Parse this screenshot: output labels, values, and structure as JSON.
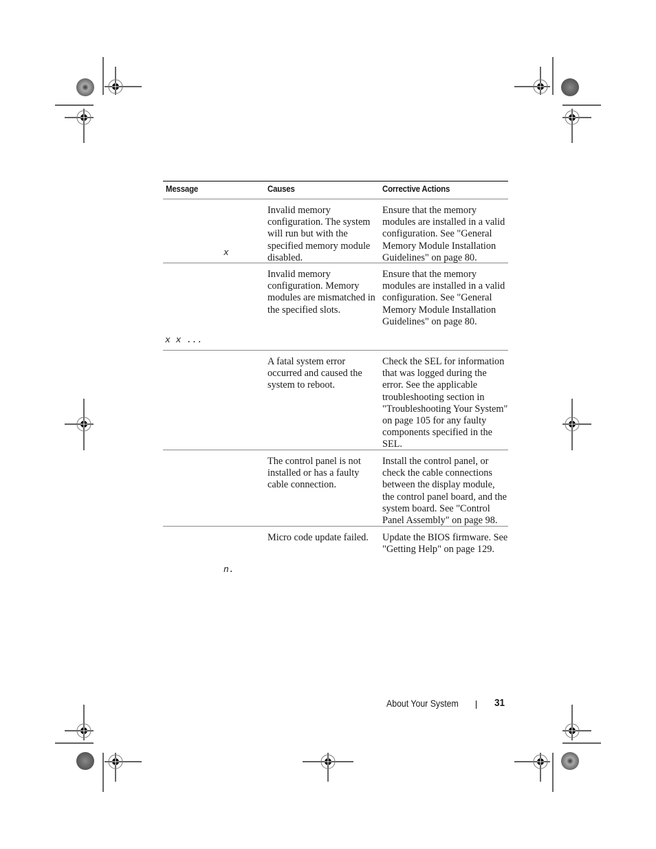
{
  "table": {
    "headers": [
      "Message",
      "Causes",
      "Corrective Actions"
    ],
    "rows": [
      {
        "message_fragment": "x",
        "causes": "Invalid memory configuration. The system will run but with the specified memory module disabled.",
        "actions": "Ensure that the memory modules are installed in a valid configuration. See \"General Memory Module Installation Guidelines\" on page 80."
      },
      {
        "message_fragment": "x x ...",
        "causes": "Invalid memory configuration. Memory modules are mismatched in the specified slots.",
        "actions": "Ensure that the memory modules are installed in a valid configuration. See \"General Memory Module Installation Guidelines\" on page 80."
      },
      {
        "message_fragment": "",
        "causes": "A fatal system error occurred and caused the system to reboot.",
        "actions": "Check the SEL for information that was logged during the error. See the applicable troubleshooting section in \"Troubleshooting Your System\" on page 105 for any faulty components specified in the SEL."
      },
      {
        "message_fragment": "",
        "causes": "The control panel is not installed or has a faulty cable connection.",
        "actions": "Install the control panel, or check the cable connections between the display module, the control panel board, and the system board. See \"Control Panel Assembly\" on page 98."
      },
      {
        "message_fragment": "n.",
        "causes": "Micro code update failed.",
        "actions": "Update the BIOS firmware. See \"Getting Help\" on page 129."
      }
    ]
  },
  "footer": {
    "section_title": "About Your System",
    "page_number": "31"
  }
}
